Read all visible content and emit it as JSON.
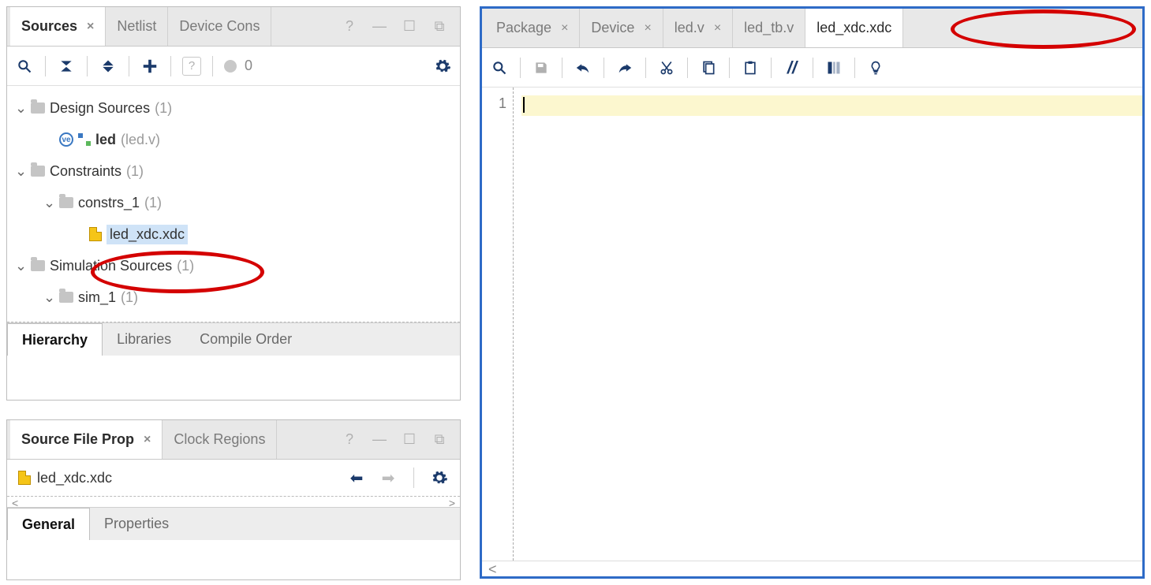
{
  "sources": {
    "tabs": {
      "sources": "Sources",
      "netlist": "Netlist",
      "device": "Device Cons"
    },
    "messages_count": "0",
    "tree": {
      "design": {
        "label": "Design Sources",
        "count": "(1)"
      },
      "led": {
        "name": "led",
        "file": "(led.v)"
      },
      "constraints": {
        "label": "Constraints",
        "count": "(1)"
      },
      "constrs1": {
        "label": "constrs_1",
        "count": "(1)"
      },
      "xdc": {
        "label": "led_xdc.xdc"
      },
      "sim": {
        "label": "Simulation Sources",
        "count": "(1)"
      },
      "sim1": {
        "label": "sim_1",
        "count": "(1)"
      }
    },
    "bottom": {
      "hierarchy": "Hierarchy",
      "libraries": "Libraries",
      "compile": "Compile Order"
    }
  },
  "props": {
    "tabs": {
      "main": "Source File Prop",
      "clock": "Clock Regions"
    },
    "file": "led_xdc.xdc",
    "bottom": {
      "general": "General",
      "properties": "Properties"
    }
  },
  "editor": {
    "tabs": {
      "package": "Package",
      "device": "Device",
      "ledv": "led.v",
      "ledtb": "led_tb.v",
      "xdc": "led_xdc.xdc"
    },
    "line1": "1"
  }
}
